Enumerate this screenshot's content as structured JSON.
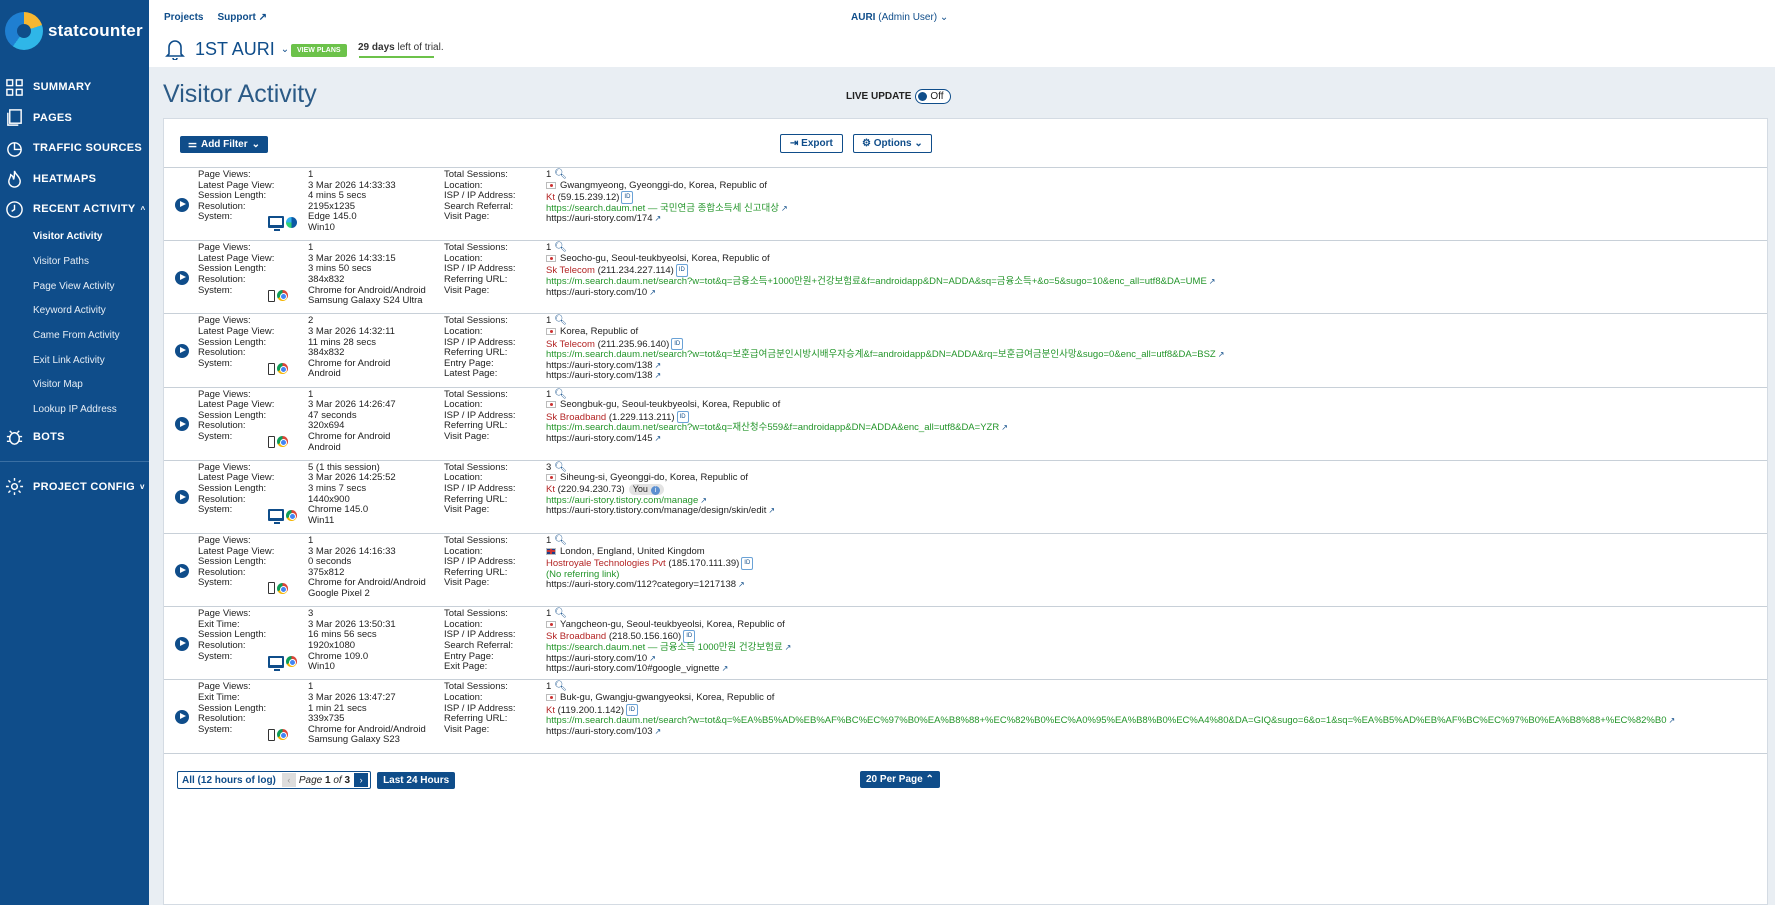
{
  "brand": "statcounter",
  "nav": {
    "summary": "SUMMARY",
    "pages": "PAGES",
    "traffic": "TRAFFIC SOURCES",
    "heatmaps": "HEATMAPS",
    "recent": "RECENT ACTIVITY",
    "recent_chevron": "^",
    "sub": [
      "Visitor Activity",
      "Visitor Paths",
      "Page View Activity",
      "Keyword Activity",
      "Came From Activity",
      "Exit Link Activity",
      "Visitor Map",
      "Lookup IP Address"
    ],
    "bots": "BOTS",
    "config": "PROJECT CONFIG",
    "config_chevron": "v"
  },
  "header": {
    "projects": "Projects",
    "support": "Support",
    "user_name": "AURI",
    "user_role": "(Admin User)",
    "project_name": "1ST AURI",
    "view_plans": "VIEW PLANS",
    "trial_days": "29 days",
    "trial_rest": "left of trial.",
    "trial_progress": 1.0
  },
  "title": "Visitor Activity",
  "live_update": {
    "label": "LIVE UPDATE",
    "state": "Off"
  },
  "toolbar": {
    "add_filter": "Add Filter",
    "export": "Export",
    "options": "Options"
  },
  "rows": [
    {
      "labels1": [
        "Page Views:",
        "Latest Page View:",
        "Session Length:",
        "Resolution:",
        "System:"
      ],
      "vals1": [
        "1",
        "3 Mar 2026 14:33:33",
        "4 mins 5 secs",
        "2195x1235",
        "Edge 145.0",
        "Win10"
      ],
      "sys": "desktop",
      "browser": "edge",
      "labels2": [
        "Total Sessions:",
        "Location:",
        "ISP / IP Address:",
        "Search Referral:",
        "Visit Page:"
      ],
      "sessions": "1",
      "location": "Gwangmyeong, Gyeonggi-do, Korea, Republic of",
      "flag": "kr",
      "isp": "Kt",
      "ip": "(59.15.239.12)",
      "referral": "https://search.daum.net — 국민연금 종합소득세 신고대상",
      "extra": [],
      "page": "https://auri-story.com/174"
    },
    {
      "labels1": [
        "Page Views:",
        "Latest Page View:",
        "Session Length:",
        "Resolution:",
        "System:"
      ],
      "vals1": [
        "1",
        "3 Mar 2026 14:33:15",
        "3 mins 50 secs",
        "384x832",
        "Chrome for Android/Android",
        "Samsung Galaxy S24 Ultra"
      ],
      "sys": "mobile",
      "browser": "chrome",
      "labels2": [
        "Total Sessions:",
        "Location:",
        "ISP / IP Address:",
        "Referring URL:",
        "Visit Page:"
      ],
      "sessions": "1",
      "location": "Seocho-gu, Seoul-teukbyeolsi, Korea, Republic of",
      "flag": "kr",
      "isp": "Sk Telecom",
      "ip": "(211.234.227.114)",
      "referral": "https://m.search.daum.net/search?w=tot&q=금융소득+1000만원+건강보험료&f=androidapp&DN=ADDA&sq=금융소득+&o=5&sugo=10&enc_all=utf8&DA=UME",
      "extra": [],
      "page": "https://auri-story.com/10"
    },
    {
      "labels1": [
        "Page Views:",
        "Latest Page View:",
        "Session Length:",
        "Resolution:",
        "System:"
      ],
      "vals1": [
        "2",
        "3 Mar 2026 14:32:11",
        "11 mins 28 secs",
        "384x832",
        "Chrome for Android",
        "Android"
      ],
      "sys": "mobile",
      "browser": "chrome",
      "labels2": [
        "Total Sessions:",
        "Location:",
        "ISP / IP Address:",
        "Referring URL:",
        "Entry Page:",
        "Latest Page:"
      ],
      "sessions": "1",
      "location": "Korea, Republic of",
      "flag": "kr",
      "isp": "Sk Telecom",
      "ip": "(211.235.96.140)",
      "referral": "https://m.search.daum.net/search?w=tot&q=보훈급여금분인시방시배우자승계&f=androidapp&DN=ADDA&rq=보훈급여금분인사망&sugo=0&enc_all=utf8&DA=BSZ",
      "extra": [
        "https://auri-story.com/138"
      ],
      "page": "https://auri-story.com/138"
    },
    {
      "labels1": [
        "Page Views:",
        "Latest Page View:",
        "Session Length:",
        "Resolution:",
        "System:"
      ],
      "vals1": [
        "1",
        "3 Mar 2026 14:26:47",
        "47 seconds",
        "320x694",
        "Chrome for Android",
        "Android"
      ],
      "sys": "mobile",
      "browser": "chrome",
      "labels2": [
        "Total Sessions:",
        "Location:",
        "ISP / IP Address:",
        "Referring URL:",
        "Visit Page:"
      ],
      "sessions": "1",
      "location": "Seongbuk-gu, Seoul-teukbyeolsi, Korea, Republic of",
      "flag": "kr",
      "isp": "Sk Broadband",
      "ip": "(1.229.113.211)",
      "referral": "https://m.search.daum.net/search?w=tot&q=재산청수559&f=androidapp&DN=ADDA&enc_all=utf8&DA=YZR",
      "extra": [],
      "page": "https://auri-story.com/145"
    },
    {
      "labels1": [
        "Page Views:",
        "Latest Page View:",
        "Session Length:",
        "Resolution:",
        "System:"
      ],
      "vals1": [
        "5 (1 this session)",
        "3 Mar 2026 14:25:52",
        "3 mins 7 secs",
        "1440x900",
        "Chrome 145.0",
        "Win11"
      ],
      "sys": "desktop",
      "browser": "chrome",
      "labels2": [
        "Total Sessions:",
        "Location:",
        "ISP / IP Address:",
        "Referring URL:",
        "Visit Page:"
      ],
      "sessions": "3",
      "location": "Siheung-si, Gyeonggi-do, Korea, Republic of",
      "flag": "kr",
      "isp": "Kt",
      "ip": "(220.94.230.73)",
      "you": "You",
      "referral": "https://auri-story.tistory.com/manage",
      "extra": [],
      "page": "https://auri-story.tistory.com/manage/design/skin/edit"
    },
    {
      "labels1": [
        "Page Views:",
        "Latest Page View:",
        "Session Length:",
        "Resolution:",
        "System:"
      ],
      "vals1": [
        "1",
        "3 Mar 2026 14:16:33",
        "0 seconds",
        "375x812",
        "Chrome for Android/Android",
        "Google Pixel 2"
      ],
      "sys": "mobile",
      "browser": "chrome",
      "labels2": [
        "Total Sessions:",
        "Location:",
        "ISP / IP Address:",
        "Referring URL:",
        "Visit Page:"
      ],
      "sessions": "1",
      "location": "London, England, United Kingdom",
      "flag": "gb",
      "isp": "Hostroyale Technologies Pvt",
      "ip": "(185.170.111.39)",
      "referral": "(No referring link)",
      "extra": [],
      "page": "https://auri-story.com/112?category=1217138"
    },
    {
      "labels1": [
        "Page Views:",
        "Exit Time:",
        "Session Length:",
        "Resolution:",
        "System:"
      ],
      "vals1": [
        "3",
        "3 Mar 2026 13:50:31",
        "16 mins 56 secs",
        "1920x1080",
        "Chrome 109.0",
        "Win10"
      ],
      "sys": "desktop",
      "browser": "chrome",
      "labels2": [
        "Total Sessions:",
        "Location:",
        "ISP / IP Address:",
        "Search Referral:",
        "Entry Page:",
        "Exit Page:"
      ],
      "sessions": "1",
      "location": "Yangcheon-gu, Seoul-teukbyeolsi, Korea, Republic of",
      "flag": "kr",
      "isp": "Sk Broadband",
      "ip": "(218.50.156.160)",
      "referral": "https://search.daum.net — 금융소득 1000만원 건강보험료",
      "extra": [
        "https://auri-story.com/10"
      ],
      "page": "https://auri-story.com/10#google_vignette"
    },
    {
      "labels1": [
        "Page Views:",
        "Exit Time:",
        "Session Length:",
        "Resolution:",
        "System:"
      ],
      "vals1": [
        "1",
        "3 Mar 2026 13:47:27",
        "1 min 21 secs",
        "339x735",
        "Chrome for Android/Android",
        "Samsung Galaxy S23"
      ],
      "sys": "mobile",
      "browser": "chrome",
      "labels2": [
        "Total Sessions:",
        "Location:",
        "ISP / IP Address:",
        "Referring URL:",
        "Visit Page:"
      ],
      "sessions": "1",
      "location": "Buk-gu, Gwangju-gwangyeoksi, Korea, Republic of",
      "flag": "kr",
      "isp": "Kt",
      "ip": "(119.200.1.142)",
      "referral": "https://m.search.daum.net/search?w=tot&q=%EA%B5%AD%EB%AF%BC%EC%97%B0%EA%B8%88+%EC%82%B0%EC%A0%95%EA%B8%B0%EC%A4%80&DA=GIQ&sugo=6&o=1&sq=%EA%B5%AD%EB%AF%BC%EC%97%B0%EA%B8%88+%EC%82%B0",
      "extra": [],
      "page": "https://auri-story.com/103"
    }
  ],
  "pager": {
    "all_label": "All (12 hours of log)",
    "page_word": "Page",
    "page_num": "1",
    "of_word": "of",
    "page_total": "3",
    "last24": "Last 24 Hours",
    "per_page": "20 Per Page"
  }
}
